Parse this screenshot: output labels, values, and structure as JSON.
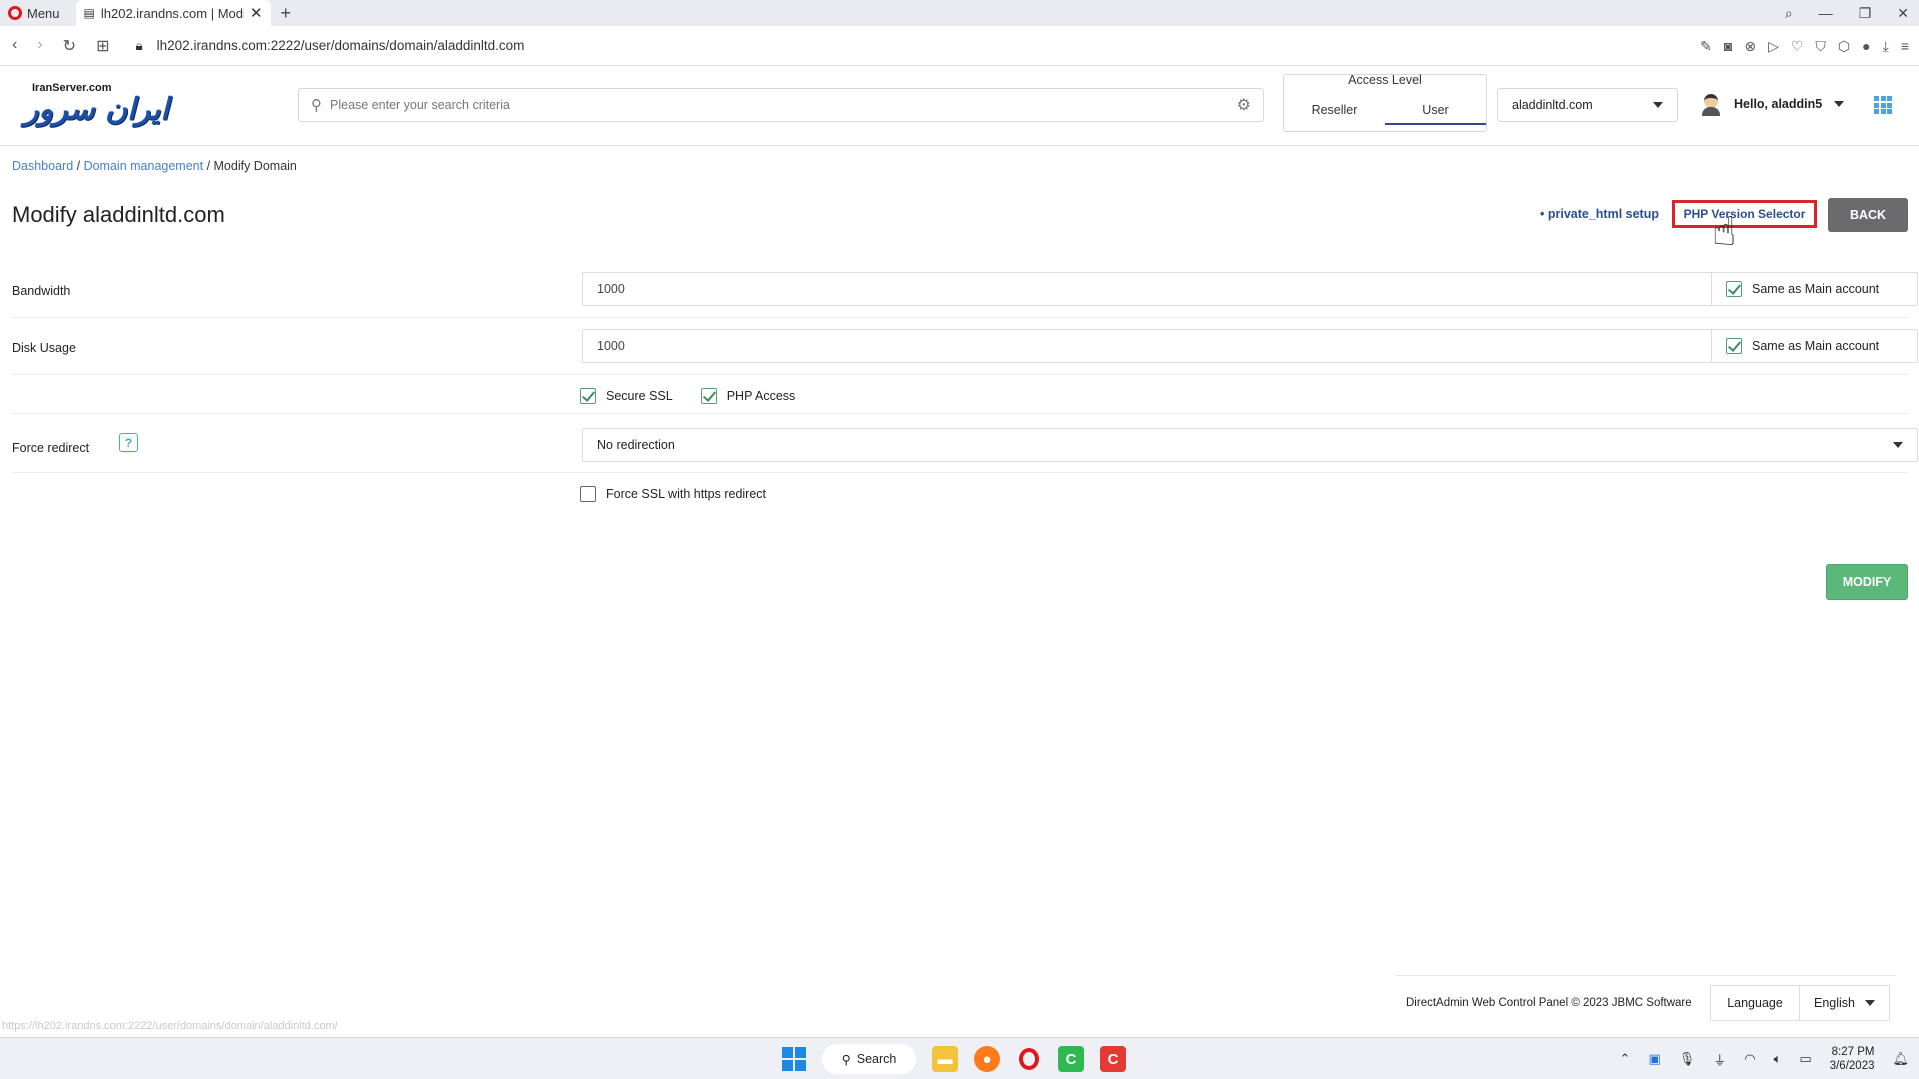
{
  "browser": {
    "menu_label": "Menu",
    "tab_title": "lh202.irandns.com | Modify",
    "tab_close": "✕",
    "new_tab": "+",
    "url_host": "lh202.irandns.com",
    "url_path": ":2222/user/domains/domain/aladdinltd.com",
    "url_prefix": "lh202."
  },
  "header": {
    "logo_top": "IranServer.com",
    "logo_main": "ایران سرور",
    "search_placeholder": "Please enter your search criteria",
    "access_level_label": "Access Level",
    "access_options": [
      "Reseller",
      "User"
    ],
    "domain_selected": "aladdinltd.com",
    "greeting": "Hello, aladdin5"
  },
  "breadcrumb": {
    "items": [
      "Dashboard",
      "Domain management",
      "Modify Domain"
    ],
    "sep": " / "
  },
  "page": {
    "title": "Modify aladdinltd.com",
    "private_html_link": "• private_html setup",
    "php_selector": "PHP Version Selector",
    "back_label": "BACK",
    "modify_label": "MODIFY"
  },
  "form": {
    "bandwidth_label": "Bandwidth",
    "bandwidth_value": "1000",
    "disk_label": "Disk Usage",
    "disk_value": "1000",
    "same_as_main": "Same as Main account",
    "secure_ssl": "Secure SSL",
    "php_access": "PHP Access",
    "force_redirect_label": "Force redirect",
    "help": "?",
    "redirect_value": "No redirection",
    "force_ssl": "Force SSL with https redirect"
  },
  "footer": {
    "copyright": "DirectAdmin Web Control Panel © 2023 JBMC Software",
    "language_label": "Language",
    "language_value": "English",
    "status_url": "https://lh202.irandns.com:2222/user/domains/domain/aladdinltd.com/"
  },
  "taskbar": {
    "search_label": "Search",
    "time": "8:27 PM",
    "date": "3/6/2023"
  },
  "colors": {
    "accent_link": "#4a7ec4",
    "highlight_red": "#d9242a",
    "modify_green": "#5cb87a",
    "back_gray": "#6b6b6e"
  }
}
